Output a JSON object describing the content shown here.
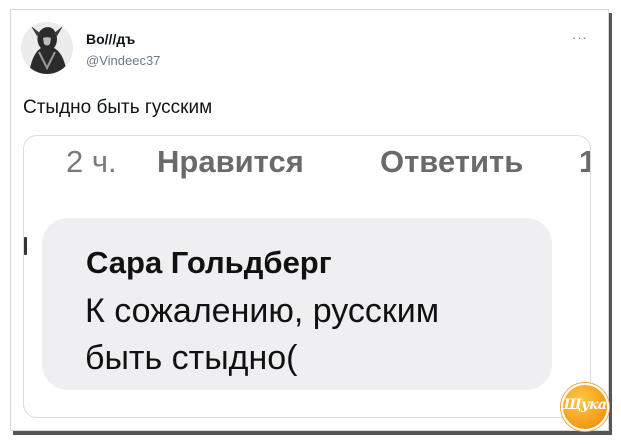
{
  "tweet": {
    "author_name": "Во///дъ",
    "author_handle": "@Vindeec37",
    "more_label": "···",
    "text": "Стыдно быть гусским"
  },
  "embedded_screenshot": {
    "meta": {
      "time": "2 ч.",
      "like": "Нравится",
      "reply": "Ответить",
      "count": "1"
    },
    "comment": {
      "author": "Сара Гольдберг",
      "line1": "К сожалению, русским",
      "line2": "быть стыдно("
    }
  },
  "watermark": {
    "text": "Щука",
    "color": "#f29a16"
  }
}
